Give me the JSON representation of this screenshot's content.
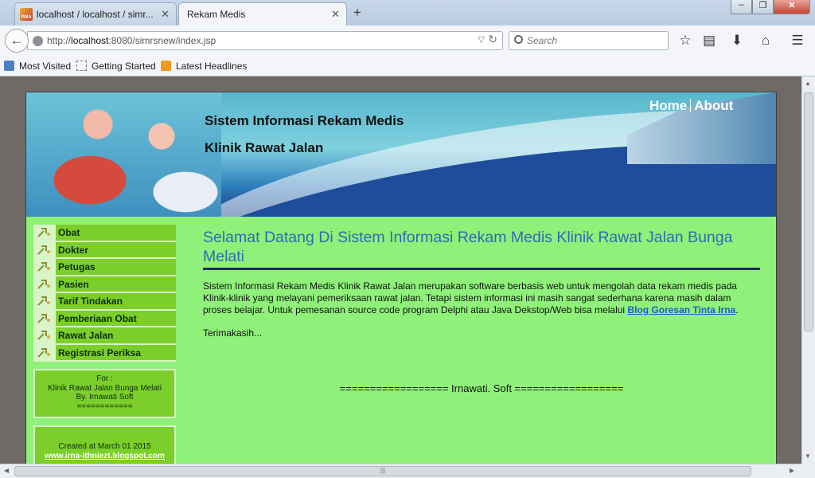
{
  "browser": {
    "tabs": [
      {
        "title": "localhost / localhost / simr...",
        "active": false
      },
      {
        "title": "Rekam Medis",
        "active": true
      }
    ],
    "url": {
      "host": "localhost",
      "rest": ":8080/simrsnew/index.jsp",
      "prefix": "http://"
    },
    "search_placeholder": "Search",
    "bookmarks": [
      "Most Visited",
      "Getting Started",
      "Latest Headlines"
    ],
    "window_controls": {
      "min": "–",
      "max": "❐",
      "close": "✕"
    }
  },
  "banner": {
    "title": "Sistem Informasi Rekam Medis",
    "subtitle": "Klinik Rawat Jalan",
    "nav": {
      "home": "Home",
      "about": "About"
    }
  },
  "sidebar": {
    "items": [
      {
        "label": "Obat"
      },
      {
        "label": "Dokter"
      },
      {
        "label": "Petugas"
      },
      {
        "label": "Pasien"
      },
      {
        "label": "Tarif Tindakan"
      },
      {
        "label": "Pemberiaan Obat"
      },
      {
        "label": "Rawat Jalan"
      },
      {
        "label": "Registrasi Periksa"
      }
    ],
    "info1": {
      "line1": "For :",
      "line2": "Klinik Rawat Jalan Bunga Melati",
      "line3": "By. Irnawati Soft",
      "line4": "============"
    },
    "info2": {
      "line1": "Created at March 01 2015",
      "link": "www.irna-ithniezt.blogspot.com"
    }
  },
  "content": {
    "title": "Selamat Datang Di Sistem Informasi Rekam Medis Klinik Rawat Jalan Bunga Melati",
    "body": "Sistem Informasi Rekam Medis Klinik Rawat Jalan merupakan software berbasis web untuk mengolah data rekam medis pada Klinik-klinik yang melayani pemeriksaan rawat jalan. Tetapi sistem informasi ini masih sangat sederhana karena masih dalam proses belajar. Untuk pemesanan source code program Delphi atau Java Dekstop/Web bisa melalui ",
    "link": "Blog Goresan Tinta Irna",
    "body_end": ".",
    "thanks": "Terimakasih...",
    "signature": "================== Irnawati. Soft =================="
  },
  "colors": {
    "page_bg": "#8ff07a",
    "menu_green": "#7ccf2a",
    "title_blue": "#2f6bb5"
  }
}
